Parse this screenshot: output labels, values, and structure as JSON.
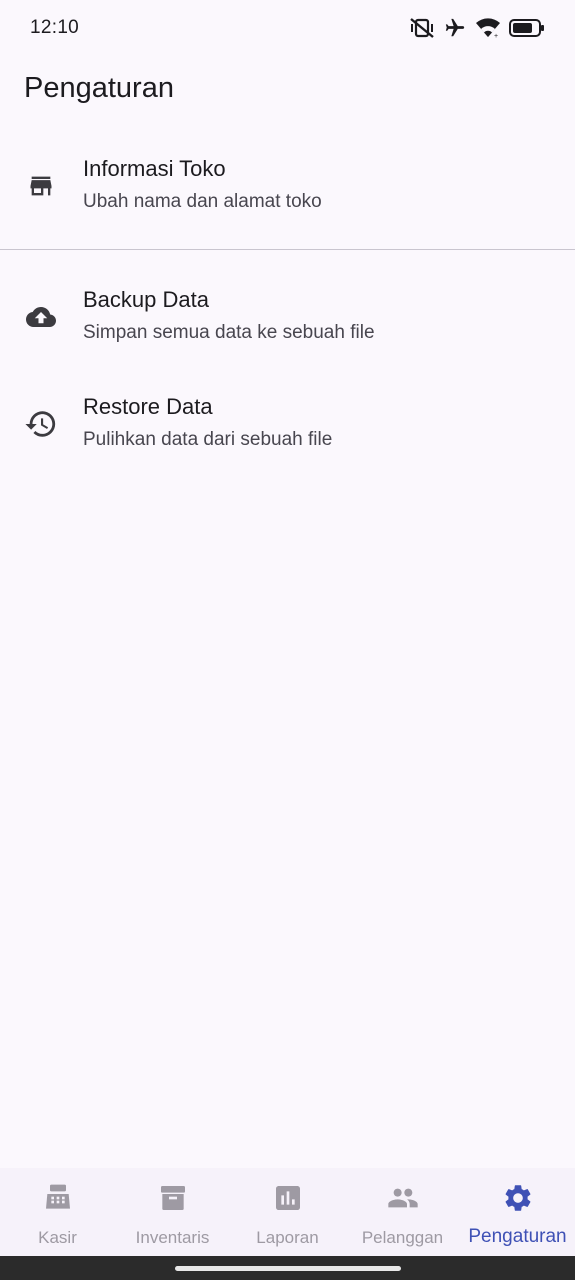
{
  "status_bar": {
    "time": "12:10"
  },
  "app_bar": {
    "title": "Pengaturan"
  },
  "settings": {
    "items": [
      {
        "icon": "store-icon",
        "title": "Informasi Toko",
        "subtitle": "Ubah nama dan alamat toko"
      },
      {
        "icon": "cloud-upload-icon",
        "title": "Backup Data",
        "subtitle": "Simpan semua data ke sebuah file"
      },
      {
        "icon": "history-icon",
        "title": "Restore Data",
        "subtitle": "Pulihkan data dari sebuah file"
      }
    ]
  },
  "bottom_nav": {
    "items": [
      {
        "icon": "cash-register-icon",
        "label": "Kasir",
        "active": false
      },
      {
        "icon": "archive-icon",
        "label": "Inventaris",
        "active": false
      },
      {
        "icon": "bar-chart-icon",
        "label": "Laporan",
        "active": false
      },
      {
        "icon": "people-icon",
        "label": "Pelanggan",
        "active": false
      },
      {
        "icon": "gear-icon",
        "label": "Pengaturan",
        "active": true
      }
    ]
  },
  "colors": {
    "background": "#fbf8fd",
    "accent": "#3f51b5",
    "inactive": "#9e9aa3",
    "text": "#1c1b1f"
  }
}
